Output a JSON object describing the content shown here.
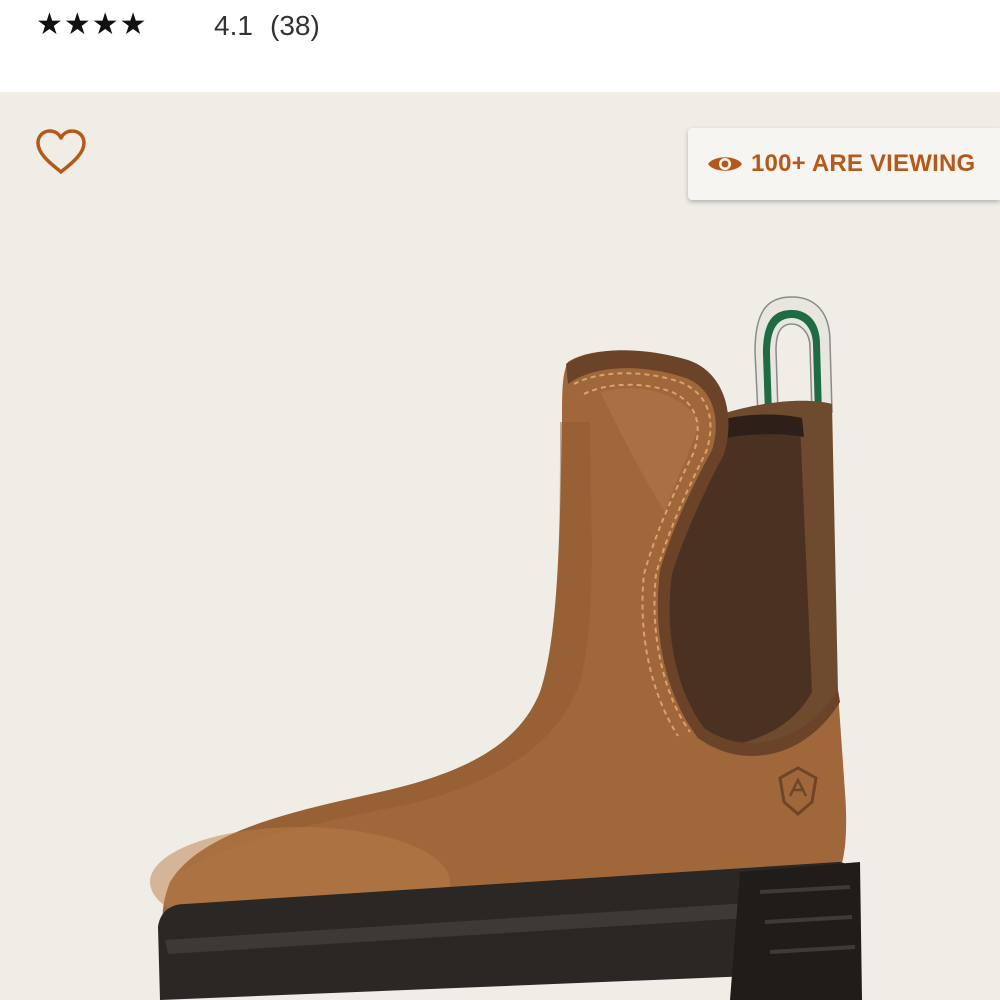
{
  "rating": {
    "stars_display": "★★★★",
    "value": "4.1",
    "count": "(38)"
  },
  "product_image": {
    "favorite_icon": "heart-outline-icon",
    "viewing_badge": {
      "icon": "eye-icon",
      "label": "100+ ARE VIEWING"
    },
    "colors": {
      "background": "#f0ede7",
      "accent": "#b5591a",
      "boot_leather": "#a0673a",
      "boot_elastic": "#4a3122",
      "sole": "#2b2724",
      "pull_tab": "#1f6b43"
    }
  }
}
